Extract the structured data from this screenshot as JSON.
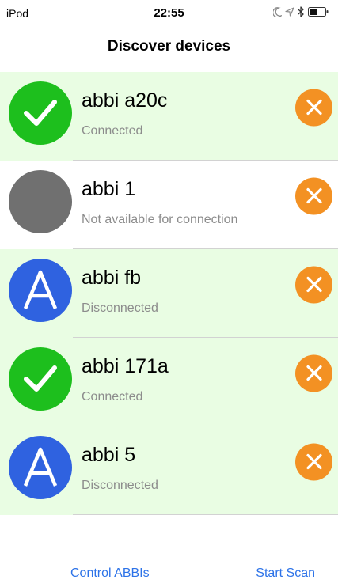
{
  "status_bar": {
    "carrier": "iPod",
    "time": "22:55"
  },
  "nav": {
    "title": "Discover devices"
  },
  "devices": [
    {
      "name": "abbi a20c",
      "status": "Connected",
      "state": "connected"
    },
    {
      "name": "abbi 1",
      "status": "Not available for connection",
      "state": "unavailable"
    },
    {
      "name": "abbi fb",
      "status": "Disconnected",
      "state": "disconnected"
    },
    {
      "name": "abbi 171a",
      "status": "Connected",
      "state": "connected"
    },
    {
      "name": "abbi 5",
      "status": "Disconnected",
      "state": "disconnected"
    }
  ],
  "badge_letter": "A",
  "toolbar": {
    "control_label": "Control ABBIs",
    "scan_label": "Start Scan"
  },
  "colors": {
    "connected": "#1dbf1d",
    "unavailable": "#707070",
    "disconnected": "#2f62e0",
    "remove": "#f39123",
    "row_highlight": "#e9fde3",
    "link": "#2d73e8"
  },
  "icons": {
    "connected": "checkmark-icon",
    "disconnected": "letter-a-icon",
    "remove": "close-icon"
  }
}
